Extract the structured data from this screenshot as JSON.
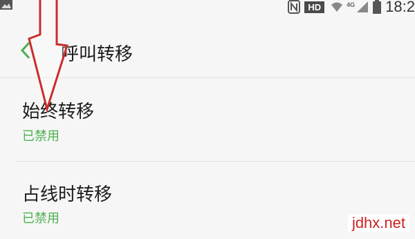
{
  "status_bar": {
    "left_icon": "image-icon",
    "icons": [
      "nfc-icon",
      "wifi-icon",
      "signal-icon",
      "battery-icon"
    ],
    "hd_label": "HD",
    "network_label": "4G",
    "time": "18:2"
  },
  "header": {
    "back_icon": "chevron-left-icon",
    "title": "呼叫转移"
  },
  "items": [
    {
      "title": "始终转移",
      "status": "已禁用"
    },
    {
      "title": "占线时转移",
      "status": "已禁用"
    }
  ],
  "annotation": {
    "icon": "down-arrow-icon",
    "color": "#cc2b2b"
  },
  "colors": {
    "accent_green": "#4caf50",
    "background": "#f6f6f6",
    "watermark_red": "#cc2222"
  },
  "watermark": "jdhx.net"
}
